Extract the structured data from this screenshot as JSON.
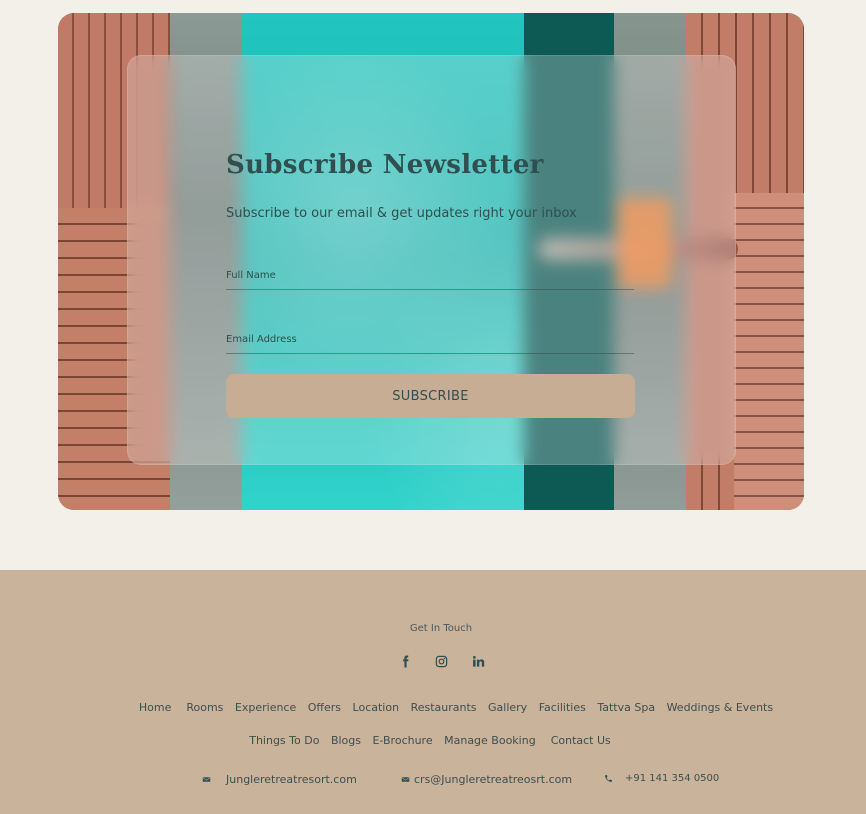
{
  "newsletter": {
    "title": "Subscribe Newsletter",
    "subtitle": "Subscribe to our email & get updates right  your inbox",
    "full_name_placeholder": "Full Name",
    "email_placeholder": "Email Address",
    "subscribe_label": "SUBSCRIBE"
  },
  "footer": {
    "get_in_touch": "Get In Touch",
    "social": [
      "facebook-icon",
      "instagram-icon",
      "linkedin-icon"
    ],
    "nav_primary": [
      "Home",
      "Rooms",
      "Experience",
      "Offers",
      "Location",
      "Restaurants",
      "Gallery",
      "Facilities",
      "Tattva Spa",
      "Weddings & Events"
    ],
    "nav_secondary": [
      "Things To Do",
      "Blogs",
      "E-Brochure",
      "Manage Booking",
      "Contact Us"
    ],
    "contact": {
      "website": "Jungleretreatresort.com",
      "email": "crs@Jungleretreatreosrt.com",
      "phone": "+91 141 354 0500"
    }
  },
  "colors": {
    "page_bg": "#f3efe9",
    "footer_bg": "#cab39b",
    "button_bg": "#c8ad95",
    "text_dark": "#2f4f50"
  }
}
